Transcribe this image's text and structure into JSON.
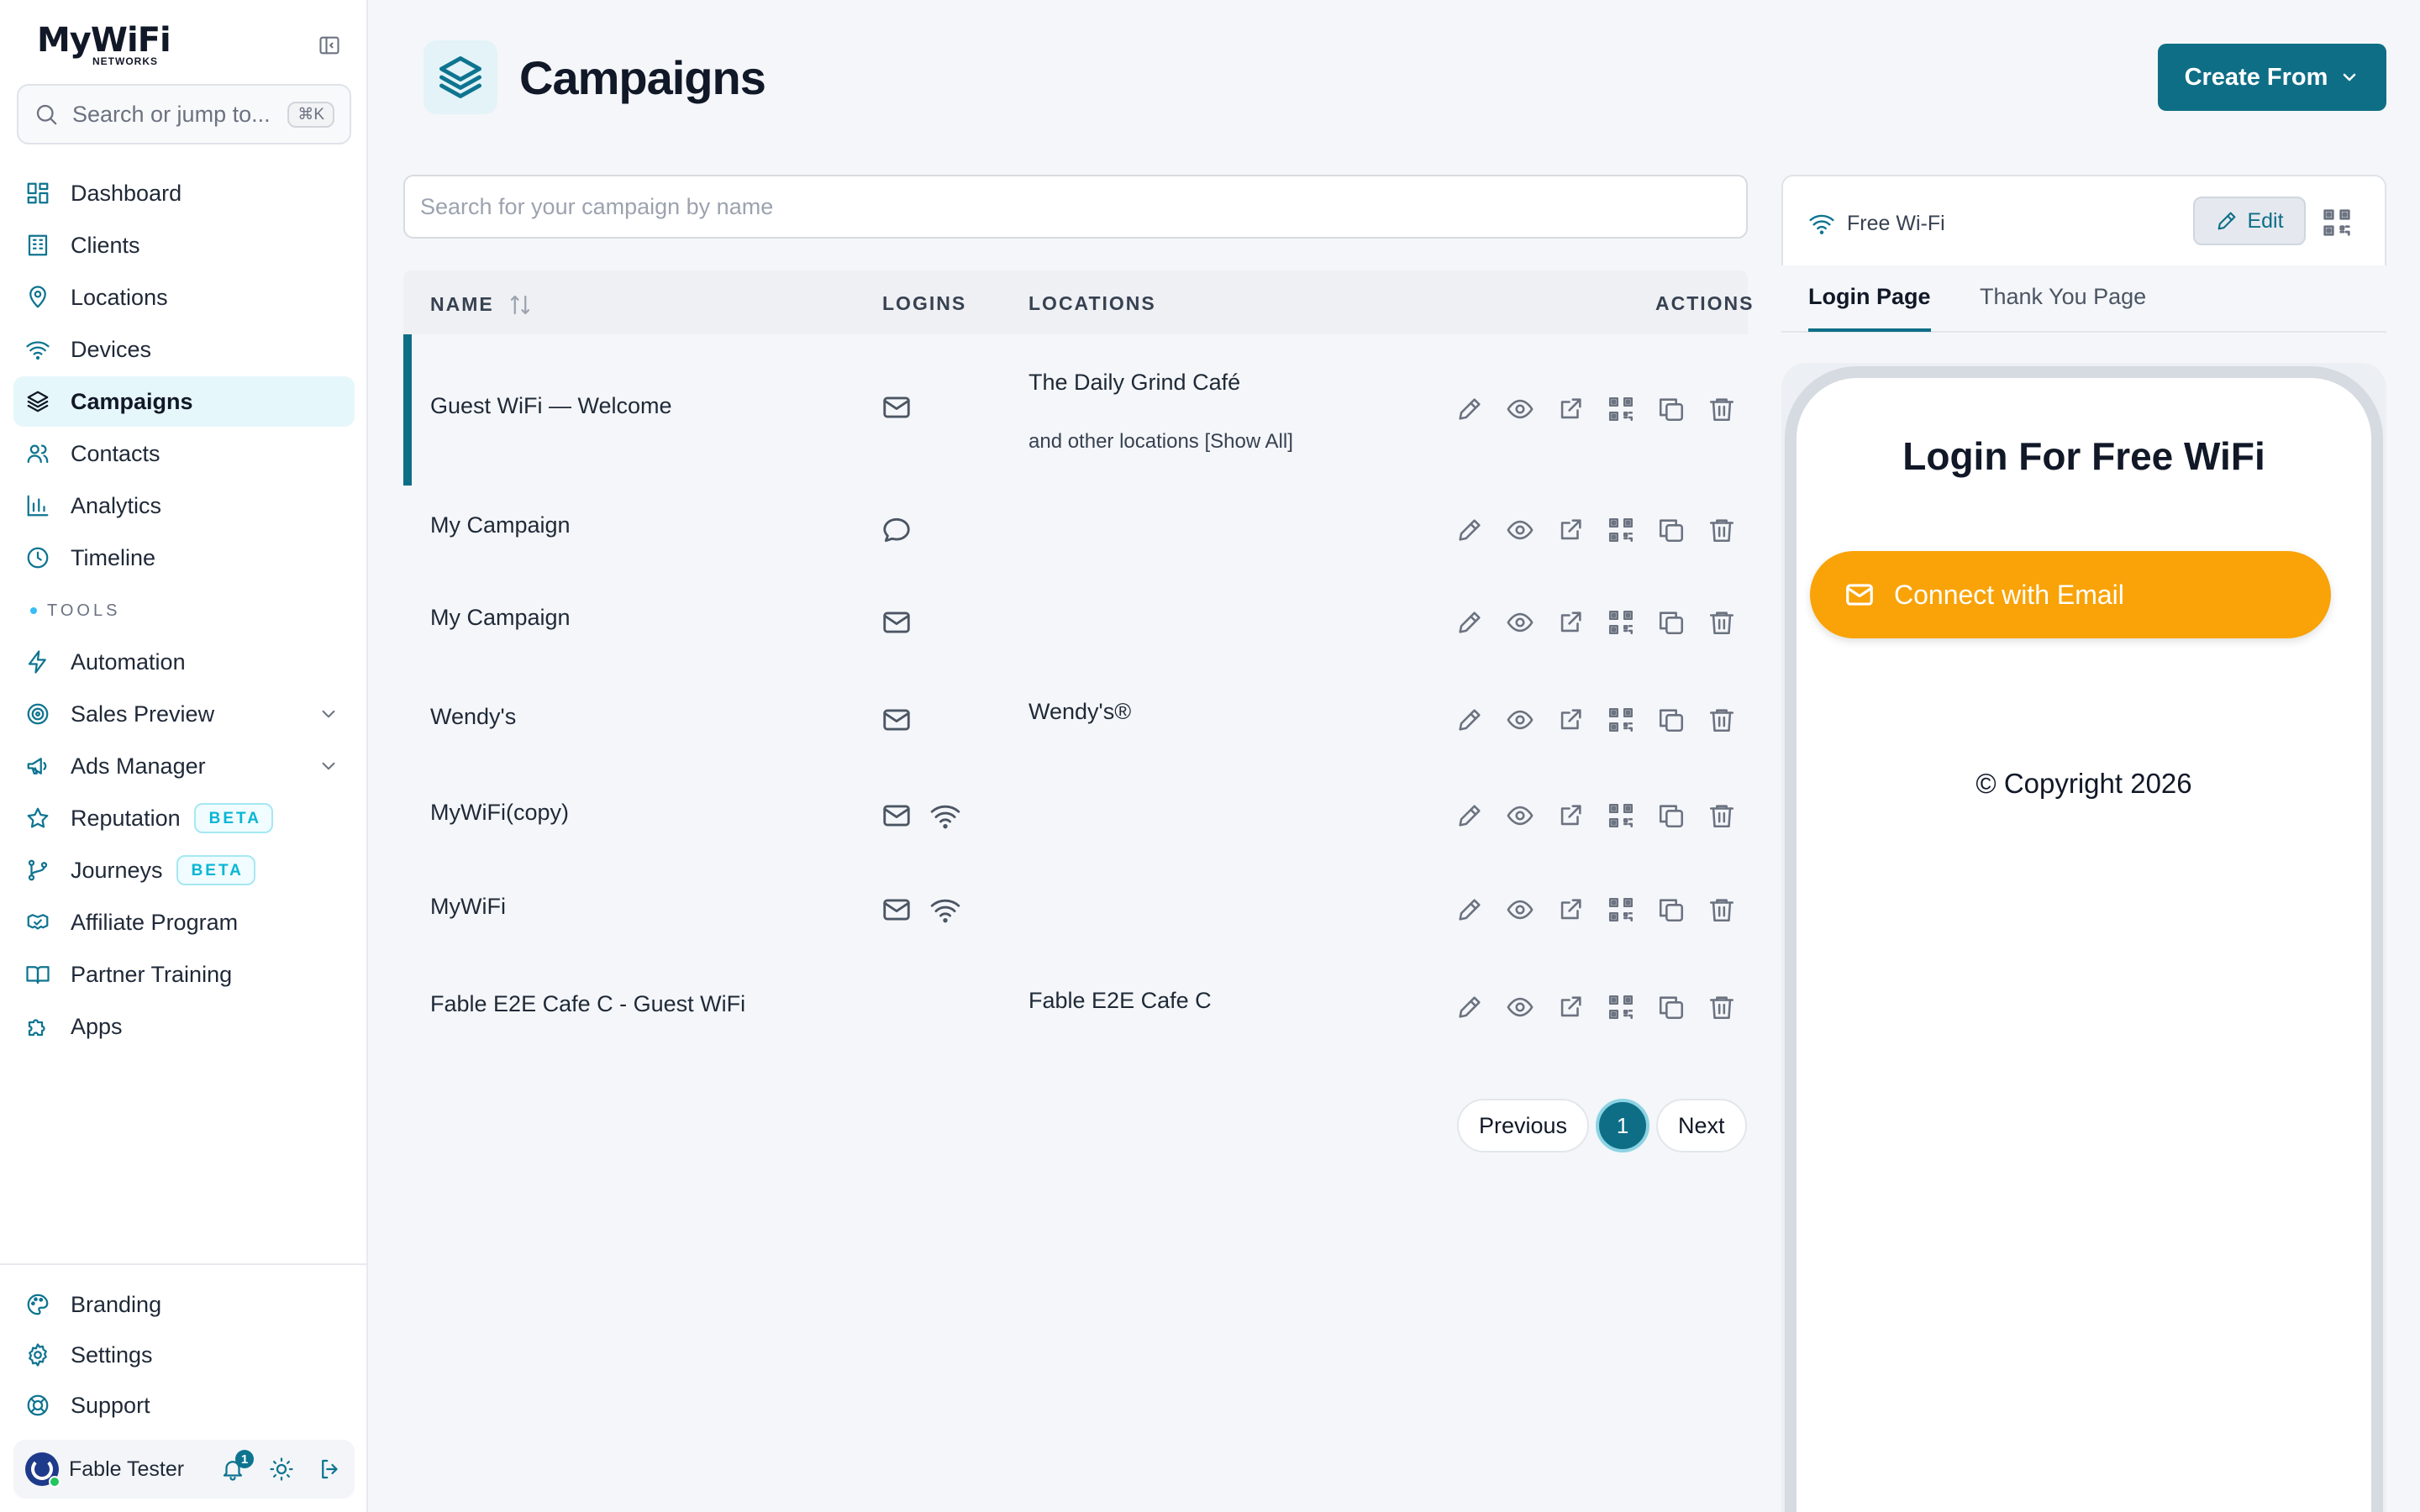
{
  "brand": {
    "name": "MyWiFi",
    "sub": "NETWORKS"
  },
  "search_jump": {
    "placeholder": "Search or jump to...",
    "shortcut": "⌘K"
  },
  "nav": {
    "items": [
      {
        "label": "Dashboard",
        "icon": "dashboard-icon"
      },
      {
        "label": "Clients",
        "icon": "building-icon"
      },
      {
        "label": "Locations",
        "icon": "map-pin-icon"
      },
      {
        "label": "Devices",
        "icon": "wifi-icon"
      },
      {
        "label": "Campaigns",
        "icon": "layers-icon",
        "active": true
      },
      {
        "label": "Contacts",
        "icon": "users-icon"
      },
      {
        "label": "Analytics",
        "icon": "bar-chart-icon"
      },
      {
        "label": "Timeline",
        "icon": "clock-icon"
      }
    ],
    "tools_heading": "TOOLS",
    "tools": [
      {
        "label": "Automation",
        "icon": "bolt-icon"
      },
      {
        "label": "Sales Preview",
        "icon": "target-icon",
        "expandable": true
      },
      {
        "label": "Ads Manager",
        "icon": "megaphone-icon",
        "expandable": true
      },
      {
        "label": "Reputation",
        "icon": "star-icon",
        "badge": "BETA"
      },
      {
        "label": "Journeys",
        "icon": "git-branch-icon",
        "badge": "BETA"
      },
      {
        "label": "Affiliate Program",
        "icon": "handshake-icon"
      },
      {
        "label": "Partner Training",
        "icon": "book-icon"
      },
      {
        "label": "Apps",
        "icon": "puzzle-icon"
      }
    ],
    "bottom": [
      {
        "label": "Branding",
        "icon": "palette-icon"
      },
      {
        "label": "Settings",
        "icon": "gear-icon"
      },
      {
        "label": "Support",
        "icon": "lifebuoy-icon"
      }
    ]
  },
  "user": {
    "name": "Fable Tester",
    "notifications": "1"
  },
  "page": {
    "title": "Campaigns",
    "create_label": "Create From"
  },
  "campaign_search": {
    "placeholder": "Search for your campaign by name"
  },
  "table": {
    "headers": {
      "name": "NAME",
      "logins": "LOGINS",
      "locations": "LOCATIONS",
      "actions": "ACTIONS"
    },
    "rows": [
      {
        "name": "Guest WiFi — Welcome",
        "logins": [
          "mail"
        ],
        "location": "The Daily Grind Café",
        "location_sub": "and other locations [Show All]",
        "selected": true
      },
      {
        "name": "My Campaign",
        "logins": [
          "chat"
        ],
        "location": "",
        "location_sub": ""
      },
      {
        "name": "My Campaign",
        "logins": [
          "mail"
        ],
        "location": "",
        "location_sub": ""
      },
      {
        "name": "Wendy's",
        "logins": [
          "mail"
        ],
        "location": "Wendy's®",
        "location_sub": ""
      },
      {
        "name": "MyWiFi(copy)",
        "logins": [
          "mail",
          "wifi"
        ],
        "location": "",
        "location_sub": ""
      },
      {
        "name": "MyWiFi",
        "logins": [
          "mail",
          "wifi"
        ],
        "location": "",
        "location_sub": ""
      },
      {
        "name": "Fable E2E Cafe C - Guest WiFi",
        "logins": [],
        "location": "Fable E2E Cafe C",
        "location_sub": ""
      }
    ]
  },
  "pagination": {
    "previous": "Previous",
    "current": "1",
    "next": "Next"
  },
  "preview": {
    "campaign_name": "Free Wi-Fi",
    "edit_label": "Edit",
    "tabs": [
      "Login Page",
      "Thank You Page"
    ],
    "active_tab": 0,
    "login_title": "Login For Free WiFi",
    "connect_label": "Connect with Email",
    "copyright": "© Copyright 2026",
    "accent_color": "#f9a308"
  },
  "colors": {
    "primary": "#0e6e86",
    "accent_light": "#e6f7fb"
  }
}
